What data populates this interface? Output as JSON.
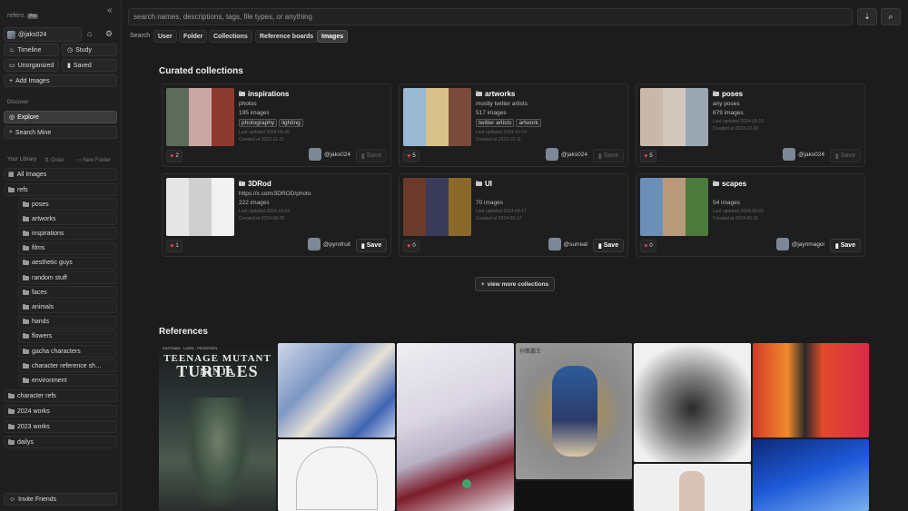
{
  "app": {
    "brand": "refero.",
    "badge": "Pro"
  },
  "user": {
    "handle": "@jaks024"
  },
  "nav": {
    "timeline": "Timeline",
    "study": "Study",
    "unorganized": "Unorganized",
    "saved": "Saved",
    "add_images": "Add Images"
  },
  "discover": {
    "label": "Discover",
    "explore": "Explore",
    "search_mine": "Search Mine"
  },
  "library": {
    "label": "Your Library",
    "order": "Order",
    "new_folder": "New Folder",
    "all_images": "All Images",
    "refs": "refs",
    "sub": [
      "poses",
      "artworks",
      "inspirations",
      "films",
      "aesthetic guys",
      "random stuff",
      "faces",
      "animals",
      "hands",
      "flowers",
      "gacha characters",
      "character reference sh…",
      "environment"
    ],
    "folders": [
      "character refs",
      "2024 works",
      "2023 works",
      "dailys"
    ]
  },
  "invite": "Invite Friends",
  "search": {
    "placeholder": "search names, descriptions, tags, file types, or anything"
  },
  "filters": {
    "label": "Search",
    "chips": [
      "User",
      "Folder",
      "Collections",
      "Reference boards",
      "Images"
    ],
    "active": "Images"
  },
  "sections": {
    "curated": "Curated collections",
    "references": "References"
  },
  "collections": [
    {
      "title": "inspirations",
      "desc": "photos",
      "count": "195 images",
      "tags": [
        "photography",
        "lighting"
      ],
      "updated": "Last updated 2024-09-28",
      "created": "Created at 2023-11-11",
      "likes": "2",
      "owner": "@jaks024",
      "save": "Save",
      "save_disabled": true,
      "colors": [
        "#5c6b5a",
        "#c9a7a2",
        "#8e3b2f"
      ]
    },
    {
      "title": "artworks",
      "desc": "mostly twitter artists",
      "count": "517 images",
      "tags": [
        "twitter artists",
        "artwork"
      ],
      "updated": "Last updated 2024-10-14",
      "created": "Created at 2023-12-11",
      "likes": "5",
      "owner": "@jaks024",
      "save": "Save",
      "save_disabled": true,
      "colors": [
        "#9ab8d2",
        "#d8c08a",
        "#7a4b3a"
      ]
    },
    {
      "title": "poses",
      "desc": "any poses",
      "count": "679 images",
      "tags": [],
      "updated": "Last updated 2024-09-19",
      "created": "Created at 2023-12-30",
      "likes": "5",
      "owner": "@jaks024",
      "save": "Save",
      "save_disabled": true,
      "colors": [
        "#c9b8aa",
        "#d2c7bd",
        "#9aa6b0"
      ]
    },
    {
      "title": "3DRod",
      "desc": "https://x.com/3DROD/photo",
      "count": "222 images",
      "tags": [],
      "updated": "Last updated 2024-10-04",
      "created": "Created at 2024-08-05",
      "likes": "1",
      "owner": "@pyrofruit",
      "save": "Save",
      "save_disabled": false,
      "colors": [
        "#e6e6e6",
        "#cfcfcf",
        "#f2f2f2"
      ]
    },
    {
      "title": "UI",
      "desc": "",
      "count": "70 images",
      "tags": [],
      "updated": "Last updated 2024-09-17",
      "created": "Created at 2024-09-17",
      "likes": "0",
      "owner": "@surreal",
      "save": "Save",
      "save_disabled": false,
      "colors": [
        "#6a3a2a",
        "#3b3b5a",
        "#8a6a2a"
      ]
    },
    {
      "title": "scapes",
      "desc": "",
      "count": "54 images",
      "tags": [],
      "updated": "Last updated 2024-09-03",
      "created": "Created at 2024-05-11",
      "likes": "0",
      "owner": "@jaynmagoi",
      "save": "Save",
      "save_disabled": false,
      "colors": [
        "#6b8fb8",
        "#b89a7a",
        "#4c7a3a"
      ]
    }
  ],
  "more_button": "view more collections",
  "tmnt": {
    "top": "EASTMAN · LAIRD · PEDERSEN",
    "title1": "TEENAGE MUTANT NINJA",
    "title2": "TURTLES"
  },
  "ref_badge": "孙策霸王"
}
